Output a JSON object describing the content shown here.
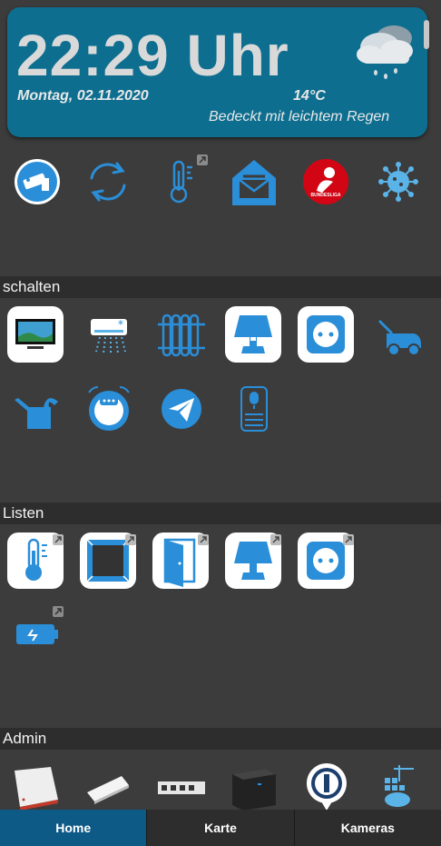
{
  "header": {
    "time": "22:29 Uhr",
    "date": "Montag, 02.11.2020",
    "temperature": "14°C",
    "condition": "Bedeckt mit leichtem Regen",
    "weather_icon": "cloud-rain-icon"
  },
  "sections": {
    "schalten": "schalten",
    "listen": "Listen",
    "admin": "Admin"
  },
  "nav": {
    "home": "Home",
    "karte": "Karte",
    "kameras": "Kameras"
  },
  "colors": {
    "background": "#3c3c3c",
    "header_bg": "#0d6e8f",
    "icon_blue": "#2a8ed8",
    "nav_active": "#0d5a86",
    "section_bg": "#2d2d2d",
    "bundesliga_red": "#d20515"
  },
  "top_icons": [
    "camera-icon",
    "refresh-icon",
    "thermometer-icon",
    "mailbox-icon",
    "bundesliga-icon",
    "virus-icon"
  ],
  "schalten_icons": [
    "tv-icon",
    "air-conditioner-icon",
    "radiator-icon",
    "lamp-icon",
    "socket-icon",
    "lawnmower-icon",
    "watering-can-icon",
    "robot-vacuum-icon",
    "telegram-icon",
    "smart-speaker-icon"
  ],
  "listen_icons": [
    "thermometer-list-icon",
    "window-list-icon",
    "door-list-icon",
    "lamp-list-icon",
    "socket-list-icon",
    "battery-icon"
  ],
  "admin_icons": [
    "fritzbox-icon",
    "usb-stick-icon",
    "switch-icon",
    "nas-icon",
    "iobroker-icon",
    "docker-icon"
  ]
}
